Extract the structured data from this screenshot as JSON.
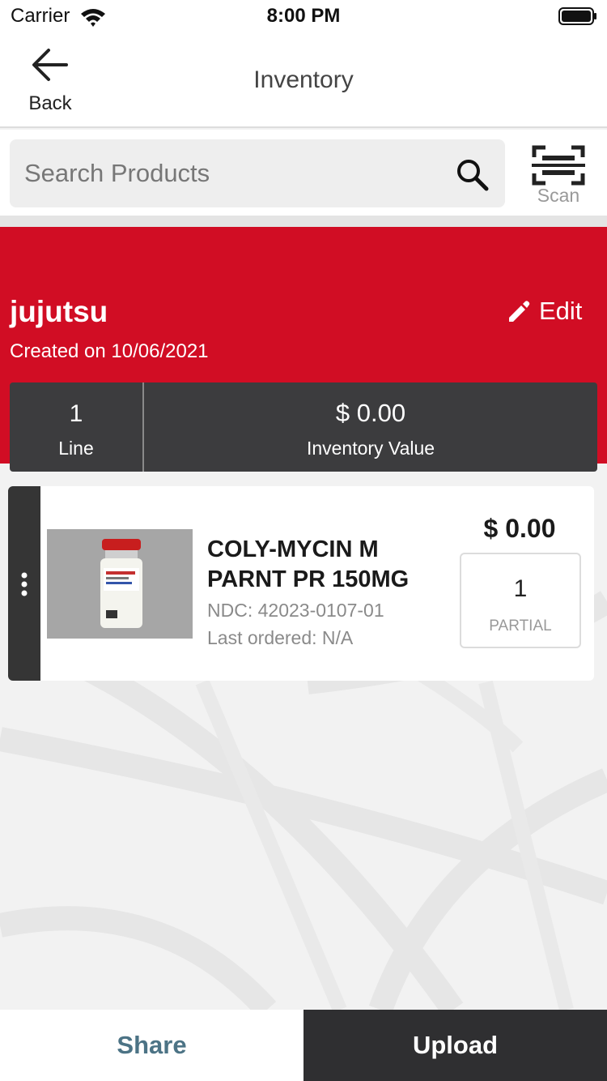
{
  "status_bar": {
    "carrier": "Carrier",
    "time": "8:00 PM",
    "wifi_icon": "wifi-icon",
    "battery_icon": "battery-icon"
  },
  "nav": {
    "back_label": "Back",
    "back_icon": "arrow-left-icon",
    "title": "Inventory"
  },
  "search": {
    "placeholder": "Search Products",
    "value": "",
    "icon": "search-icon",
    "scan_label": "Scan",
    "scan_icon": "barcode-scan-icon"
  },
  "inventory": {
    "name": "jujutsu",
    "created": "Created on 10/06/2021",
    "edit_label": "Edit",
    "edit_icon": "pencil-icon",
    "lines_count": "1",
    "lines_label": "Line",
    "value_amount": "$ 0.00",
    "value_label": "Inventory Value"
  },
  "products": [
    {
      "name": "COLY-MYCIN M PARNT PR 150MG",
      "ndc": "NDC: 42023-0107-01",
      "last_ordered": "Last ordered: N/A",
      "price": "$ 0.00",
      "quantity": "1",
      "quantity_label": "PARTIAL",
      "menu_icon": "more-vertical-icon"
    }
  ],
  "bottom": {
    "share_label": "Share",
    "upload_label": "Upload"
  },
  "colors": {
    "brand_red": "#d10d24",
    "dark": "#3c3c3e",
    "share_text": "#4c7385"
  }
}
